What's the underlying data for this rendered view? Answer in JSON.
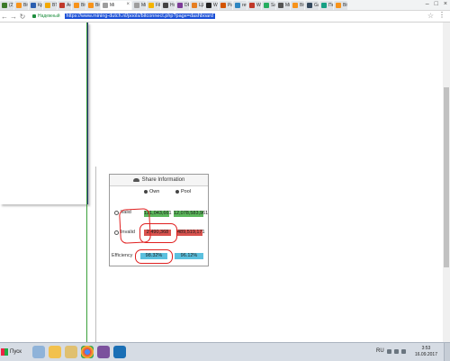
{
  "browser": {
    "tabs": [
      {
        "title": "(2)",
        "color": "#3b7a2a"
      },
      {
        "title": "Bit",
        "color": "#f7931a"
      },
      {
        "title": "Кр",
        "color": "#2b5fb0"
      },
      {
        "title": "BT",
        "color": "#f2a900"
      },
      {
        "title": "Ан",
        "color": "#c0392b"
      },
      {
        "title": "Bit",
        "color": "#f7931a"
      },
      {
        "title": "Bit",
        "color": "#f7931a"
      },
      {
        "title": "Mi",
        "color": "#9e9e9e",
        "active": true
      },
      {
        "title": "Mi",
        "color": "#9e9e9e"
      },
      {
        "title": "Fil",
        "color": "#f4b400"
      },
      {
        "title": "Ho",
        "color": "#444"
      },
      {
        "title": "DP",
        "color": "#7d3c98"
      },
      {
        "title": "ЦЕ",
        "color": "#e67e22"
      },
      {
        "title": "Wi",
        "color": "#222"
      },
      {
        "title": "Ра",
        "color": "#d35400"
      },
      {
        "title": "ret",
        "color": "#2e86c1"
      },
      {
        "title": "Wo",
        "color": "#c0392b"
      },
      {
        "title": "Sa",
        "color": "#27ae60"
      },
      {
        "title": "Mi",
        "color": "#555"
      },
      {
        "title": "Bit",
        "color": "#f7931a"
      },
      {
        "title": "Ga",
        "color": "#34495e"
      },
      {
        "title": "Пе",
        "color": "#16a085"
      },
      {
        "title": "Bit",
        "color": "#f7931a"
      }
    ],
    "security_label": "Надежный",
    "url": "https://www.mining-dutch.nl/pools/bitconnect.php?page=dashboard"
  },
  "share_info": {
    "title": "Share Information",
    "col_own": "Own",
    "col_pool": "Pool",
    "rows": [
      {
        "label": "Valid",
        "own": "121,043,661",
        "pool": "12,078,583,961"
      },
      {
        "label": "Invalid",
        "own": "2,490,368",
        "pool": "489,519,171"
      },
      {
        "label": "Efficiency",
        "own": "98.32%",
        "pool": "96.12%"
      }
    ]
  },
  "taskbar": {
    "start_label": "Пуск",
    "lang": "RU",
    "time": "3:53",
    "date": "16.09.2017"
  },
  "colors": {
    "accent_link": "#1a4fd6",
    "badge_green": "#5cb85c",
    "badge_red": "#d9534f",
    "badge_blue": "#5bc0de",
    "annotation_red": "#e02020"
  }
}
